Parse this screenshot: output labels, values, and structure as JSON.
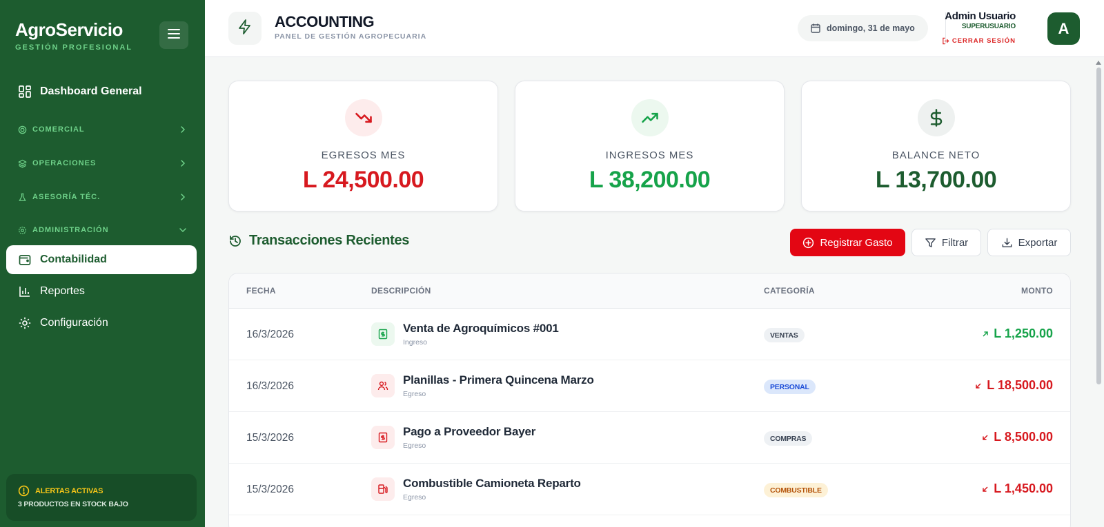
{
  "brand": {
    "name": "AgroServicio",
    "subtitle": "GESTIÓN PROFESIONAL"
  },
  "sidebar": {
    "dashboard": "Dashboard General",
    "sections": [
      {
        "label": "COMERCIAL",
        "icon": "target-icon"
      },
      {
        "label": "OPERACIONES",
        "icon": "layers-icon"
      },
      {
        "label": "ASESORÍA TÉC.",
        "icon": "flask-icon"
      },
      {
        "label": "ADMINISTRACIÓN",
        "icon": "gear-icon"
      }
    ],
    "items": [
      {
        "label": "Contabilidad",
        "icon": "wallet-icon",
        "active": true
      },
      {
        "label": "Reportes",
        "icon": "bar-chart-icon"
      },
      {
        "label": "Configuración",
        "icon": "gear-icon"
      }
    ],
    "alert": {
      "title": "ALERTAS ACTIVAS",
      "message": "3 PRODUCTOS EN STOCK BAJO"
    }
  },
  "header": {
    "title": "ACCOUNTING",
    "subtitle": "PANEL DE GESTIÓN AGROPECUARIA",
    "date": "domingo, 31 de mayo",
    "user_name": "Admin Usuario",
    "user_role": "SUPERUSUARIO",
    "logout": "CERRAR SESIÓN",
    "avatar_initial": "A"
  },
  "stats": [
    {
      "label": "EGRESOS MES",
      "value": "L 24,500.00",
      "color": "#d7191f",
      "icon": "trending-down-icon"
    },
    {
      "label": "INGRESOS MES",
      "value": "L 38,200.00",
      "color": "#16a34a",
      "icon": "trending-up-icon"
    },
    {
      "label": "BALANCE NETO",
      "value": "L 13,700.00",
      "color": "#1d5c2f",
      "icon": "dollar-icon"
    }
  ],
  "transactions": {
    "title": "Transacciones Recientes",
    "buttons": {
      "register": "Registrar Gasto",
      "filter": "Filtrar",
      "export": "Exportar"
    },
    "columns": [
      "FECHA",
      "DESCRIPCIÓN",
      "CATEGORÍA",
      "MONTO"
    ],
    "rows": [
      {
        "date": "16/3/2026",
        "description": "Venta de Agroquímicos #001",
        "type": "Ingreso",
        "category": "VENTAS",
        "amount": "L 1,250.00"
      },
      {
        "date": "16/3/2026",
        "description": "Planillas - Primera Quincena Marzo",
        "type": "Egreso",
        "category": "PERSONAL",
        "amount": "L 18,500.00"
      },
      {
        "date": "15/3/2026",
        "description": "Pago a Proveedor Bayer",
        "type": "Egreso",
        "category": "COMPRAS",
        "amount": "L 8,500.00"
      },
      {
        "date": "15/3/2026",
        "description": "Combustible Camioneta Reparto",
        "type": "Egreso",
        "category": "COMBUSTIBLE",
        "amount": "L 1,450.00"
      }
    ]
  },
  "colors": {
    "sidebar": "#1d5c2f",
    "accent_green": "#6fd28a",
    "expense": "#d7191f",
    "income": "#16a34a",
    "button_red": "#e30613"
  }
}
